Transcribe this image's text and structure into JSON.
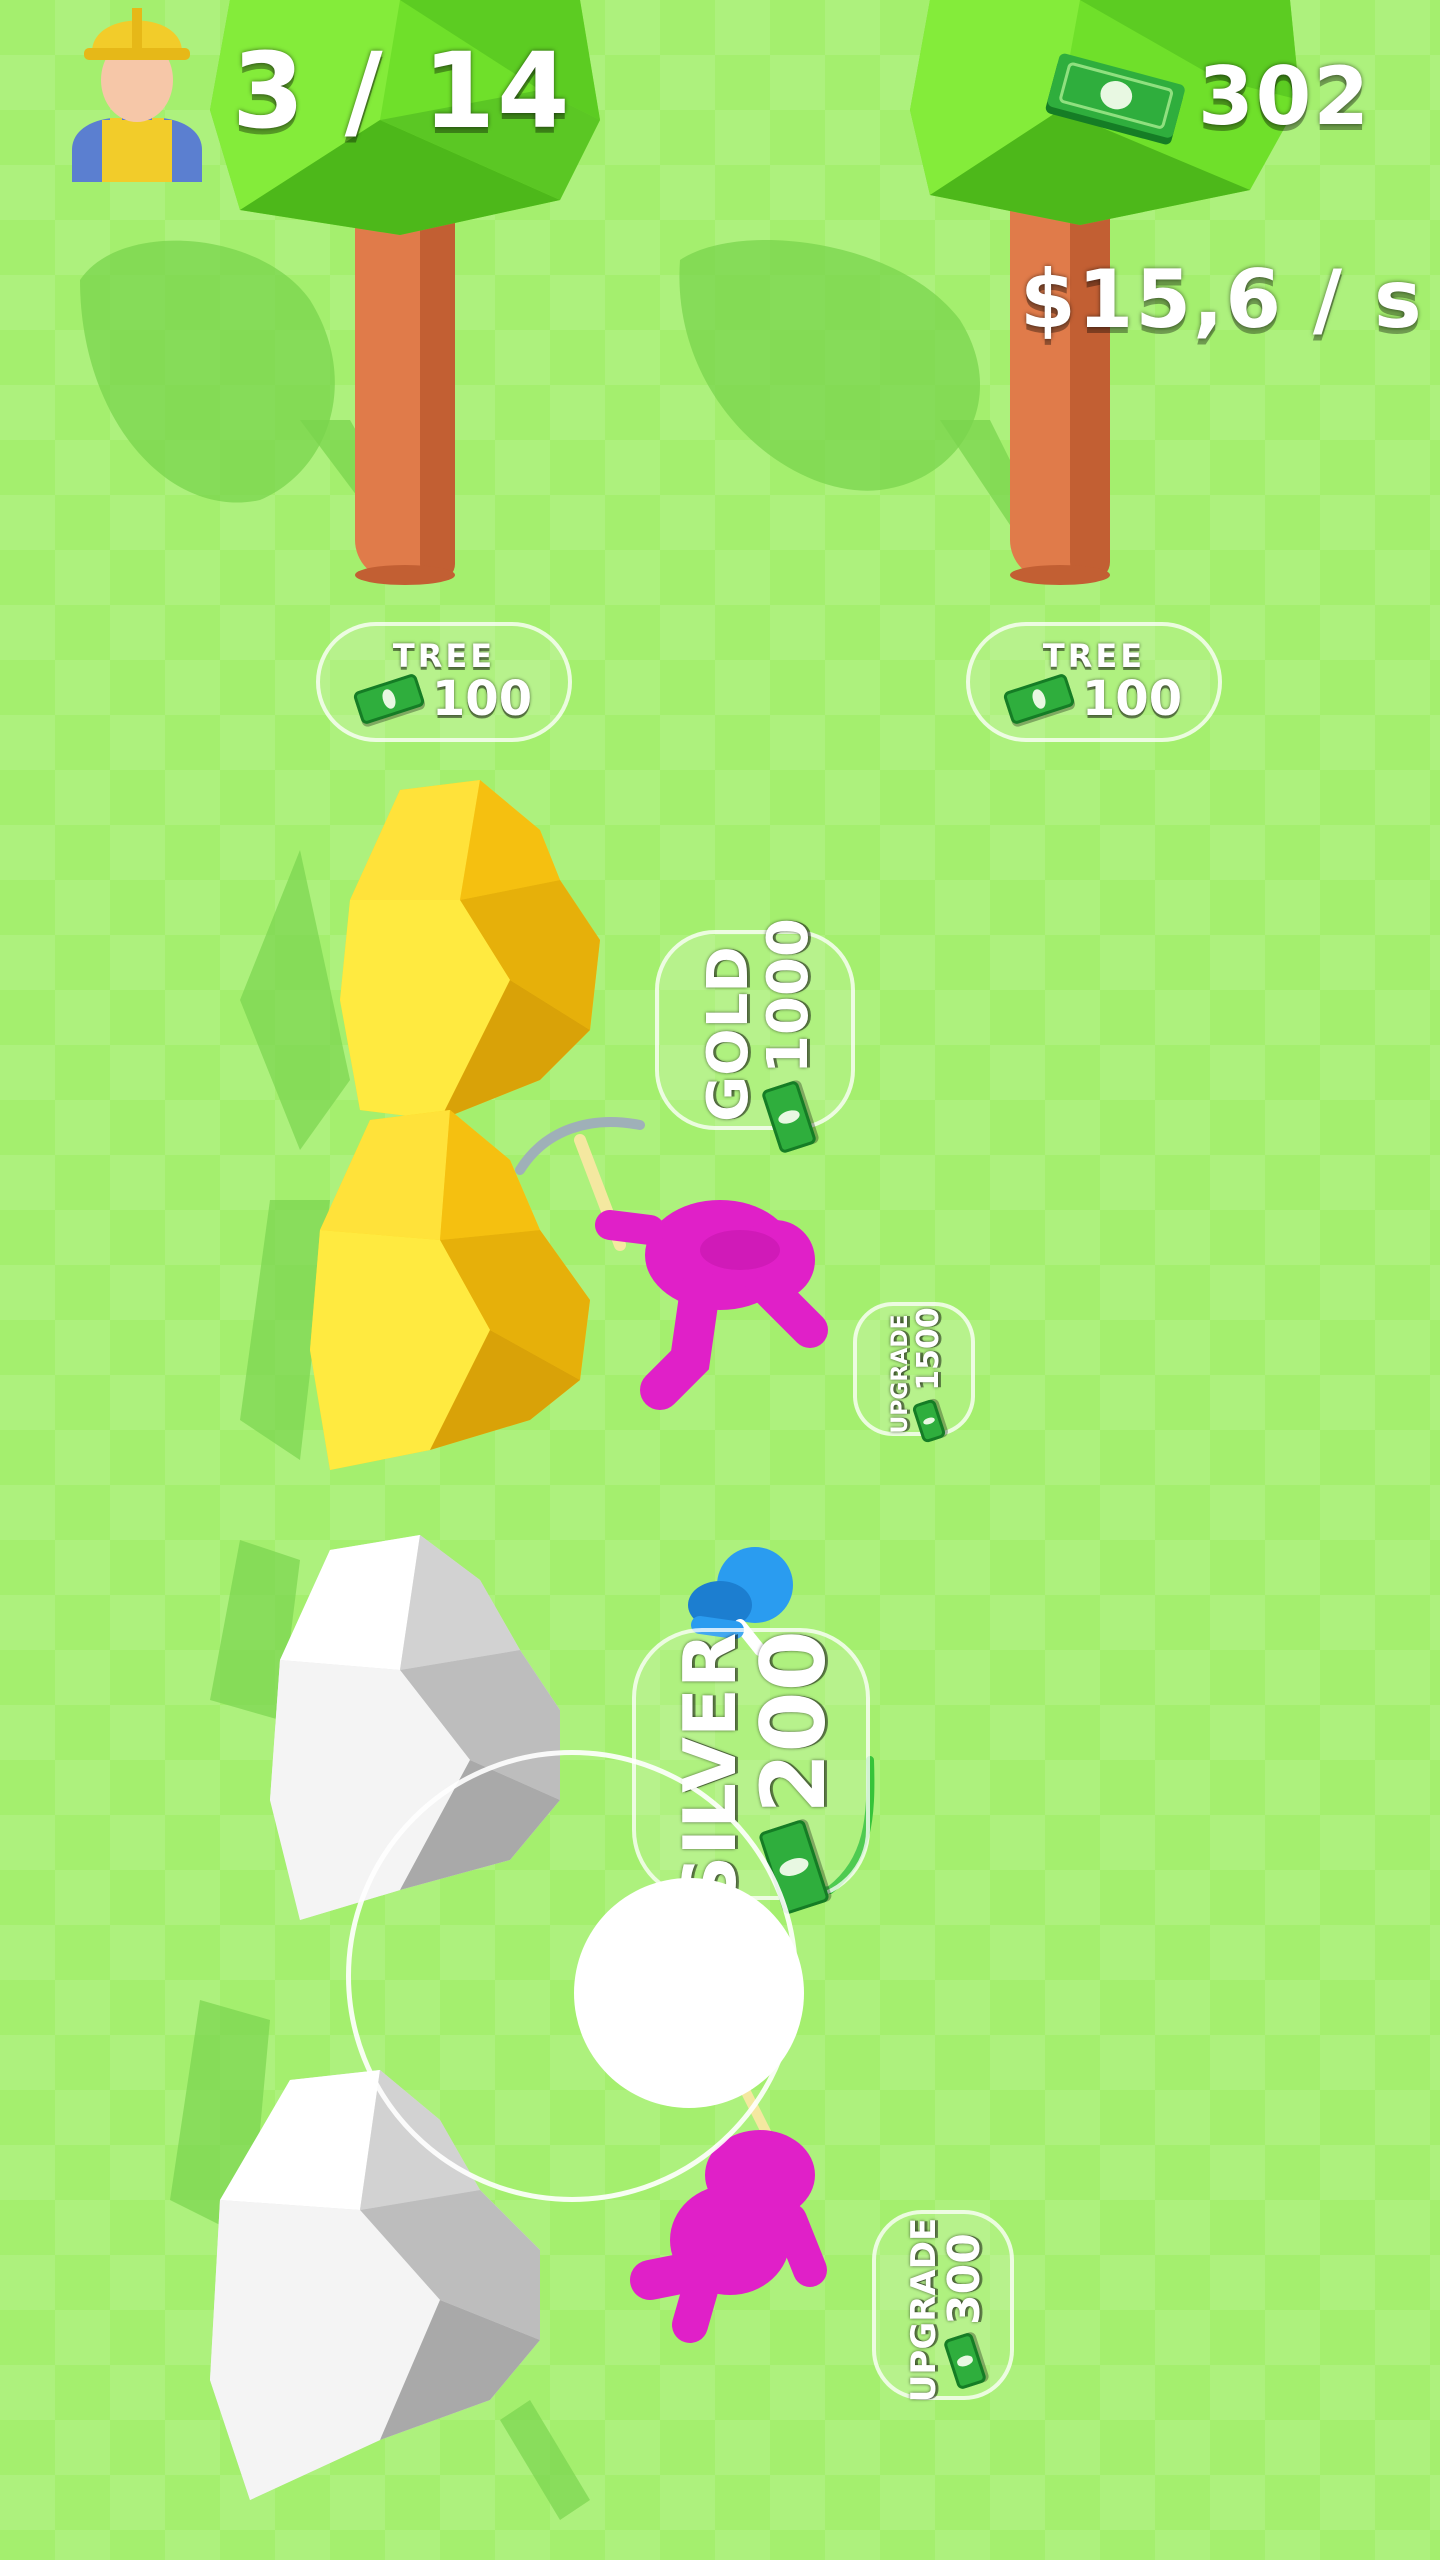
{
  "hud": {
    "worker_count": "3 / 14",
    "cash_amount": "302",
    "income_rate": "$15,6 / s",
    "worker_icon": "worker-helmet-icon",
    "cash_icon": "cash-stack-icon"
  },
  "pads": {
    "tree_left": {
      "label": "TREE",
      "price": "100"
    },
    "tree_right": {
      "label": "TREE",
      "price": "100"
    },
    "gold": {
      "label": "GOLD",
      "price": "1000"
    },
    "upgrade_top": {
      "label": "UPGRADE",
      "price": "1500"
    },
    "silver": {
      "label": "SILVER",
      "price": "200"
    },
    "upgrade_bottom": {
      "label": "UPGRADE",
      "price": "300"
    }
  },
  "colors": {
    "ground": "#a4ef6e",
    "tree_canopy": "#6fe02a",
    "tree_trunk": "#e07b4a",
    "gold_ore": "#ffd21a",
    "silver_ore": "#e6e6e6",
    "worker_magenta": "#e020c8",
    "player_blue": "#2a9cf0",
    "cash_green": "#2fae3d"
  }
}
